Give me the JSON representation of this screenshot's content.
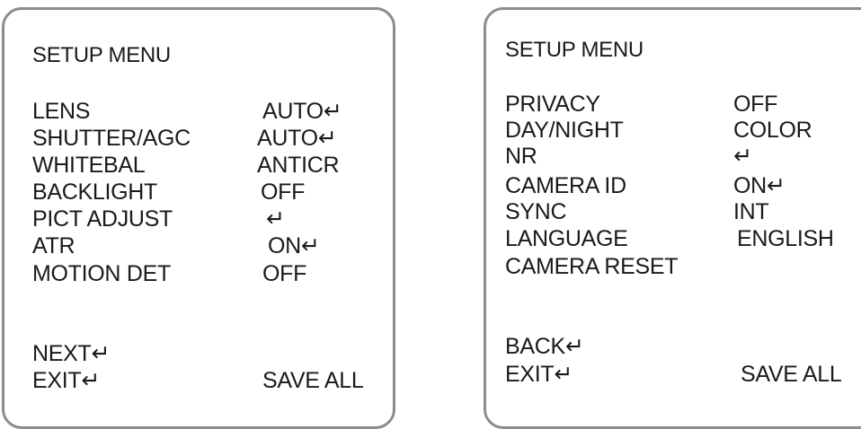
{
  "left_menu": {
    "title": "SETUP MENU",
    "rows": [
      {
        "label": "LENS",
        "value": "AUTO↵"
      },
      {
        "label": "SHUTTER/AGC",
        "value": "AUTO↵"
      },
      {
        "label": "WHITEBAL",
        "value": "ANTICR"
      },
      {
        "label": "BACKLIGHT",
        "value": "OFF"
      },
      {
        "label": "PICT ADJUST",
        "value": "↵"
      },
      {
        "label": "ATR",
        "value": "ON↵"
      },
      {
        "label": "MOTION DET",
        "value": "OFF"
      }
    ],
    "next_label": "NEXT↵",
    "exit_label": "EXIT↵",
    "save_all_label": "SAVE ALL"
  },
  "right_menu": {
    "title": "SETUP MENU",
    "rows": [
      {
        "label": "PRIVACY",
        "value": "OFF"
      },
      {
        "label": "DAY/NIGHT",
        "value": "COLOR"
      },
      {
        "label": "NR",
        "value": "↵"
      },
      {
        "label": "CAMERA ID",
        "value": "ON↵"
      },
      {
        "label": "SYNC",
        "value": "INT"
      },
      {
        "label": "LANGUAGE",
        "value": "ENGLISH"
      },
      {
        "label": "CAMERA RESET",
        "value": ""
      }
    ],
    "back_label": "BACK↵",
    "exit_label": "EXIT↵",
    "save_all_label": "SAVE ALL"
  }
}
